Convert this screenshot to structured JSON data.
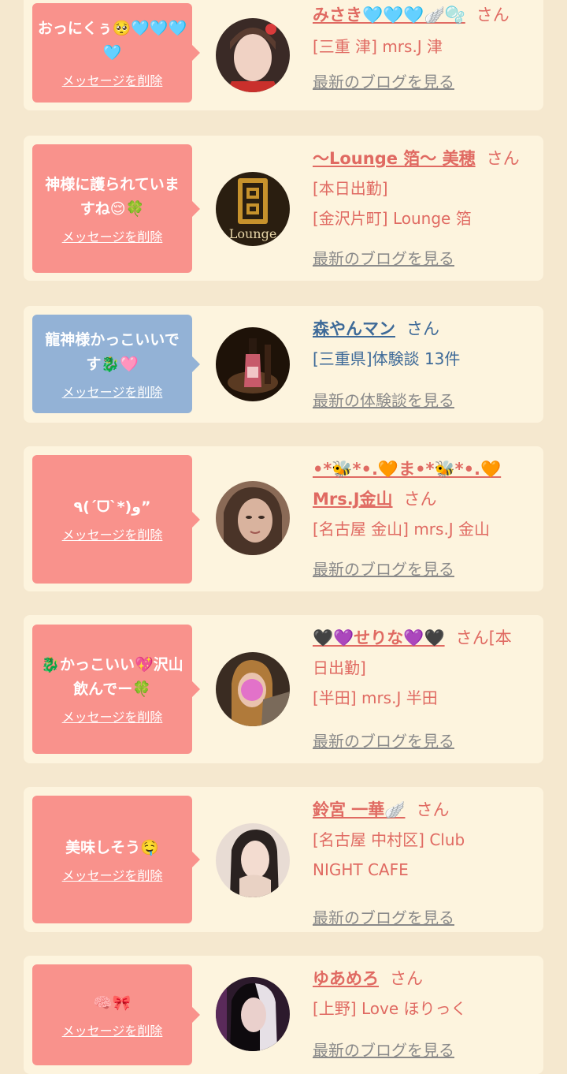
{
  "cards": [
    {
      "message": "おっにくぅ🥺🩵🩵🩵🩵",
      "delete_label": "メッセージを削除",
      "name": "みさき🩵🩵🩵🪽🫧",
      "suffix": "さん",
      "details": [
        "[三重 津] mrs.J 津"
      ],
      "link": "最新のブログを見る"
    },
    {
      "message": "神様に護られていますね😌🍀",
      "delete_label": "メッセージを削除",
      "name": "〜Lounge 箔〜 美穂",
      "suffix": "さん",
      "details": [
        "[本日出勤]",
        "[金沢片町] Lounge 箔"
      ],
      "link": "最新のブログを見る"
    },
    {
      "message": "龍神様かっこいいです🐉🩷",
      "delete_label": "メッセージを削除",
      "name": "森やんマン",
      "suffix": "さん",
      "details": [
        "[三重県]体験談 13件"
      ],
      "link": "最新の体験談を見る"
    },
    {
      "message": "٩(ˊᗜˋ*)و”",
      "delete_label": "メッセージを削除",
      "name": "•*🐝*•.🧡ま•*🐝*•.🧡",
      "name2": "Mrs.J金山",
      "suffix": "さん",
      "details": [
        "[名古屋 金山] mrs.J 金山"
      ],
      "link": "最新のブログを見る"
    },
    {
      "message": "🐉かっこいい💖沢山飲んでー🍀",
      "delete_label": "メッセージを削除",
      "name": "🖤💜せりな💜🖤",
      "suffix": "さん[本",
      "suffix2": "日出勤]",
      "details": [
        "[半田] mrs.J 半田"
      ],
      "link": "最新のブログを見る"
    },
    {
      "message": "美味しそう🤤",
      "delete_label": "メッセージを削除",
      "name": "鈴宮 一華🪽",
      "suffix": "さん",
      "details": [
        "[名古屋 中村区] Club",
        "NIGHT CAFE"
      ],
      "link": "最新のブログを見る"
    },
    {
      "message": "🧠🎀",
      "delete_label": "メッセージを削除",
      "name": "ゆあめろ",
      "suffix": "さん",
      "details": [
        "[上野] Love ほりっく"
      ],
      "link": "最新のブログを見る"
    }
  ]
}
